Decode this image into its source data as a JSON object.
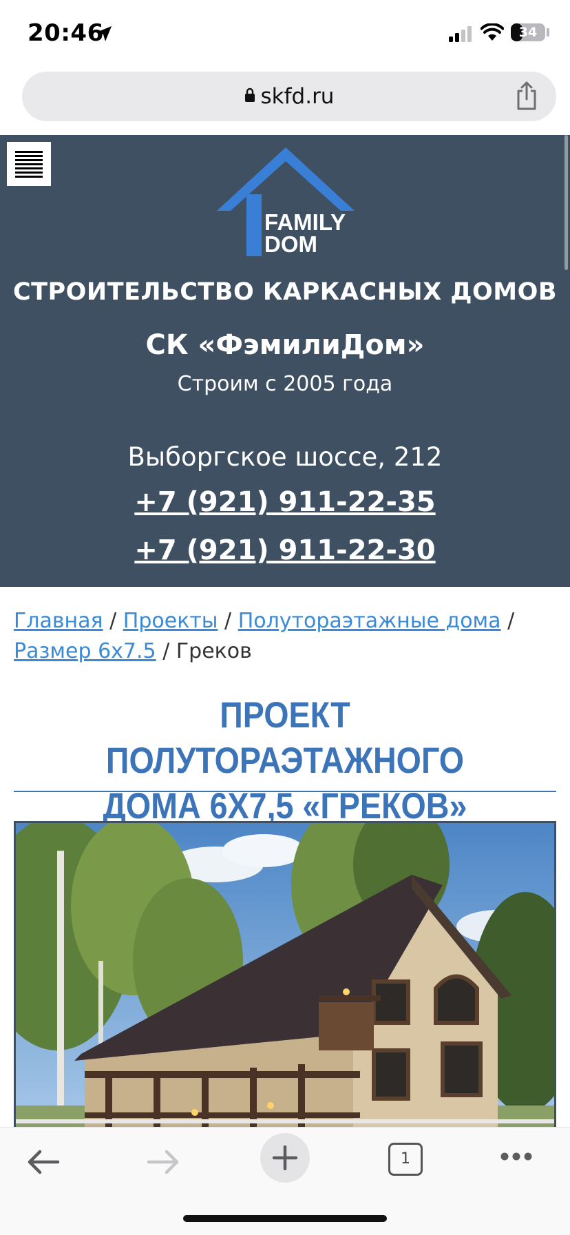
{
  "status_bar": {
    "time": "20:46",
    "battery_level": "34",
    "icons": [
      "location-arrow-icon",
      "cellular-signal-icon",
      "wifi-icon",
      "battery-icon"
    ]
  },
  "browser": {
    "url": "skfd.ru",
    "open_tabs": "1",
    "icons": [
      "lock-icon",
      "share-icon",
      "back-arrow-icon",
      "forward-arrow-icon",
      "plus-icon",
      "tabs-icon",
      "more-dots-icon"
    ]
  },
  "header": {
    "menu_icon": "hamburger-menu-icon",
    "logo_text_line1": "FAMILY",
    "logo_text_line2": "DOM",
    "site_title": "СТРОИТЕЛЬСТВО КАРКАСНЫХ ДОМОВ",
    "company": "СК «ФэмилиДом»",
    "since": "Строим с 2005 года",
    "address": "Выборгское шоссе, 212",
    "phone1": "+7 (921) 911-22-35",
    "phone2": "+7 (921) 911-22-30",
    "background_color": "#3e5062"
  },
  "breadcrumb": {
    "items": [
      {
        "label": "Главная",
        "link": true
      },
      {
        "label": "Проекты",
        "link": true
      },
      {
        "label": "Полутораэтажные дома",
        "link": true
      },
      {
        "label": "Размер 6x7.5",
        "link": true
      },
      {
        "label": "Греков",
        "link": false
      }
    ],
    "separator": "/"
  },
  "page": {
    "title_line1": "ПРОЕКТ ПОЛУТОРАЭТАЖНОГО",
    "title_line2": "ДОМА 6Х7,5 «ГРЕКОВ»",
    "accent_color": "#3b74b9",
    "link_color": "#3b8ad8"
  }
}
